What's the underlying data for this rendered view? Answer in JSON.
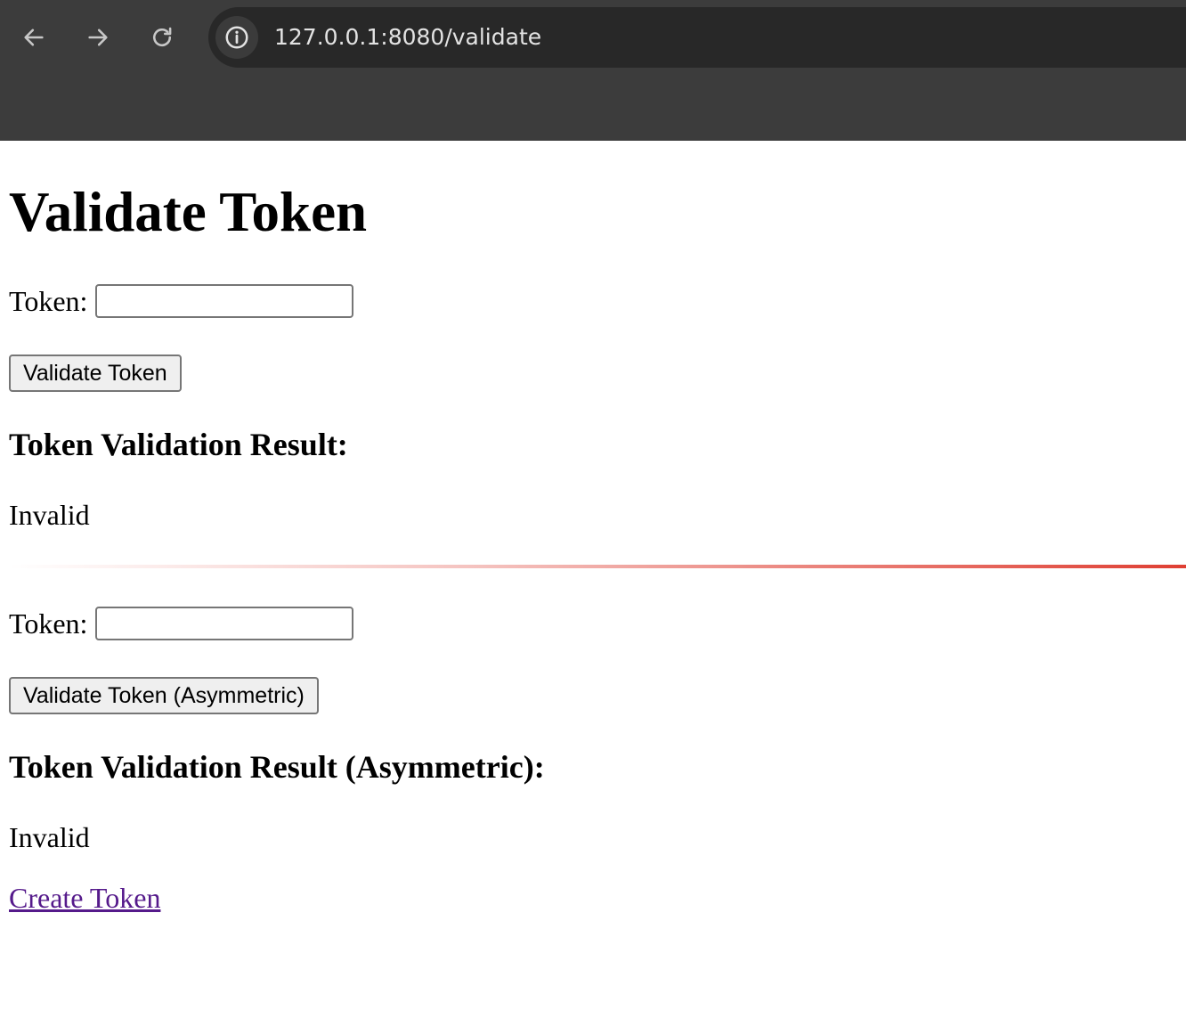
{
  "browser": {
    "url": "127.0.0.1:8080/validate",
    "icons": {
      "back": "arrow-left-icon",
      "forward": "arrow-right-icon",
      "reload": "reload-icon",
      "site_info": "info-icon"
    }
  },
  "page": {
    "title": "Validate Token",
    "symmetric": {
      "token_label": "Token:",
      "token_value": "",
      "button_label": "Validate Token",
      "result_heading": "Token Validation Result:",
      "result_value": "Invalid"
    },
    "asymmetric": {
      "token_label": "Token:",
      "token_value": "",
      "button_label": "Validate Token (Asymmetric)",
      "result_heading": "Token Validation Result (Asymmetric):",
      "result_value": "Invalid"
    },
    "create_link_label": "Create Token"
  },
  "colors": {
    "chrome_bg": "#3c3c3c",
    "omnibox_bg": "#282828",
    "link_visited": "#551a8b",
    "divider_accent": "#df3f33"
  }
}
